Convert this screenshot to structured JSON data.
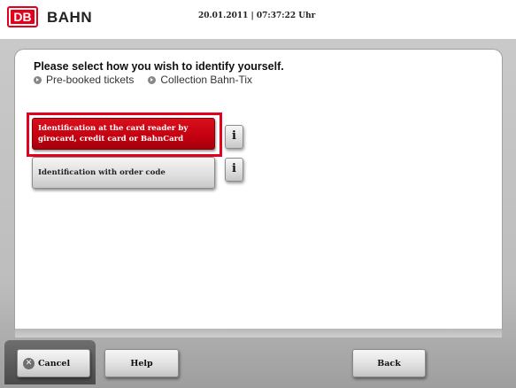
{
  "header": {
    "logo_text": "DB",
    "brand": "BAHN",
    "datetime": "20.01.2011 | 07:37:22 Uhr"
  },
  "main": {
    "title": "Please select how you wish to identify yourself.",
    "breadcrumbs": [
      "Pre-booked tickets",
      "Collection Bahn-Tix"
    ],
    "options": [
      {
        "label_line1": "Identification at the card reader by",
        "label_line2": "girocard, credit card or BahnCard",
        "selected": true,
        "info_label": "i"
      },
      {
        "label_line1": "Identification with order code",
        "selected": false,
        "info_label": "i"
      }
    ]
  },
  "footer": {
    "cancel_label": "Cancel",
    "cancel_icon": "x-circle-icon",
    "help_label": "Help",
    "back_label": "Back"
  },
  "colors": {
    "brand_red": "#e2001a",
    "selected_button": "#c40010",
    "background_gray": "#c4c4c4"
  }
}
